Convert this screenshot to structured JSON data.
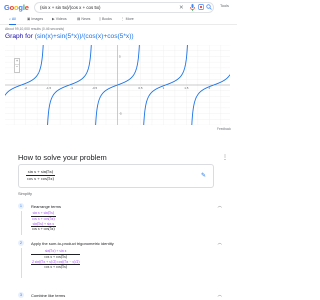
{
  "search": {
    "query": "(sin x + sin 5x)/(cos x + cos 5x)",
    "clear_icon": "close-icon",
    "voice_icon": "mic-icon",
    "lens_icon": "camera-icon",
    "search_icon": "search-icon"
  },
  "logo": {
    "letters": [
      "G",
      "o",
      "o",
      "g",
      "l",
      "e"
    ],
    "colors": [
      "#4285f4",
      "#ea4335",
      "#fbbc05",
      "#4285f4",
      "#34a853",
      "#ea4335"
    ]
  },
  "tools_label": "Tools",
  "tabs": [
    {
      "label": "All",
      "active": true
    },
    {
      "label": "Images",
      "active": false
    },
    {
      "label": "Videos",
      "active": false
    },
    {
      "label": "News",
      "active": false
    },
    {
      "label": "Books",
      "active": false
    },
    {
      "label": "More",
      "active": false
    }
  ],
  "result_stats": "About 99,10,000 results (0.46 seconds)",
  "graph": {
    "title_prefix": "Graph for ",
    "title_formula": "(sin(x)+sin(5*x))/(cos(x)+cos(5*x))",
    "x_tick_labels": [
      "-2",
      "-1.5",
      "-1",
      "-0.5",
      "0",
      "0.5",
      "1",
      "1.5",
      "2"
    ],
    "y_tick_labels": [
      "5",
      "-5"
    ],
    "zoom_in": "+",
    "zoom_out": "−",
    "feedback": "Feedback"
  },
  "chart_data": {
    "type": "line",
    "function": "(sin(x)+sin(5*x))/(cos(x)+cos(5*x)) = tan(3x)",
    "x_range": [
      -2.45,
      2.45
    ],
    "y_range": [
      -7,
      7
    ],
    "color": "#1a73e8",
    "grid": true
  },
  "solve": {
    "title": "How to solve your problem",
    "more_icon": "more-vert-icon",
    "expression_numerator": "sin x + sin(5x)",
    "expression_denominator": "cos x + cos(5x)",
    "edit_icon": "edit-icon",
    "type_label": "Simplify"
  },
  "steps": [
    {
      "number": "1",
      "label": "Rearrange terms",
      "math": {
        "a_num": "sin x + sin(5x)",
        "a_den": "cos x + cos(5x)",
        "b_num": "sin(5x) + sin x",
        "b_den": "cos x + cos(5x)"
      }
    },
    {
      "number": "2",
      "label": "Apply the sum-to-product trigonometric identity",
      "math": {
        "a_num": "sin(5x) + sin x",
        "a_den": "cos x + cos(5x)",
        "b_num_prefix": "2 sin",
        "b_arg1": "(5x + x)/2",
        "b_mid": " cos",
        "b_arg2": "(5x − x)/2",
        "b_den": "cos x + cos(5x)"
      }
    },
    {
      "number": "3",
      "label": "Combine like terms"
    }
  ],
  "step_chevron_icon": "chevron-up-icon"
}
